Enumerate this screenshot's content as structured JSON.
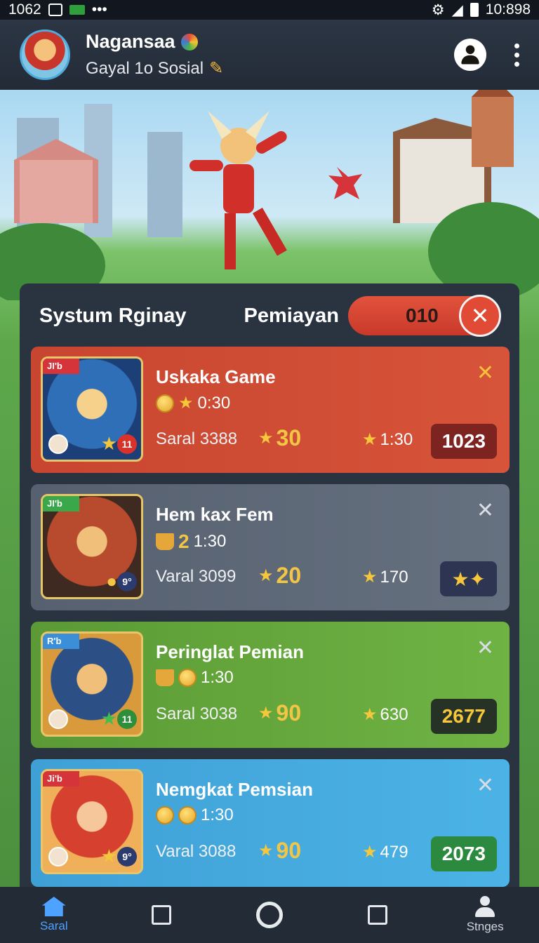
{
  "status_bar": {
    "left_text": "1062",
    "time": "10:898",
    "overflow": "•••"
  },
  "header": {
    "name": "Nagansaa",
    "subtitle": "Gayal 1o Sosial"
  },
  "panel": {
    "tab1": "Systum Rginay",
    "tab2": "Pemiayan",
    "counter": "010",
    "counter_close": "✕"
  },
  "cards": [
    {
      "title": "Uskaka Game",
      "time": "0:30",
      "ribbon": "JI'b",
      "badge": "11",
      "label": "Saral 3388",
      "bonus": "30",
      "stars": "1:30",
      "score": "1023",
      "close": "✕"
    },
    {
      "title": "Hem kax Fem",
      "bonus_top": "2",
      "time": "1:30",
      "ribbon": "JI'b",
      "badge": "9°",
      "label": "Varal 3099",
      "bonus": "20",
      "stars": "170",
      "score": "★✦",
      "close": "✕"
    },
    {
      "title": "Peringlat Pemian",
      "time": "1:30",
      "ribbon": "R'b",
      "badge": "11",
      "label": "Saral 3038",
      "bonus": "90",
      "stars": "630",
      "score": "2677",
      "close": "✕"
    },
    {
      "title": "Nemgkat Pemsian",
      "time": "1:30",
      "ribbon": "Ji'b",
      "badge": "9°",
      "label": "Varal 3088",
      "bonus": "90",
      "stars": "479",
      "score": "2073",
      "close": "✕"
    }
  ],
  "nav": {
    "home": "Saral",
    "settings": "Stnges"
  },
  "colors": {
    "accent": "#4da3ff",
    "card1": "#c8452f",
    "card2": "#5b6573",
    "card3": "#5b9a35",
    "card4": "#3fa0d6"
  }
}
